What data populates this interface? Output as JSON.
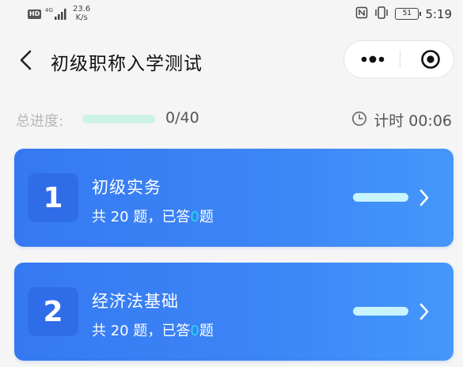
{
  "status_bar": {
    "hd": "HD",
    "network": "4G",
    "speed_value": "23.6",
    "speed_unit": "K/s",
    "battery": "51",
    "time": "5:19"
  },
  "header": {
    "title": "初级职称入学测试"
  },
  "progress": {
    "label": "总进度:",
    "count": "0/40",
    "fraction": 0,
    "timer": "计时 00:06"
  },
  "colors": {
    "card_blue": "#3579f2",
    "answered_cyan": "#29d6f2",
    "progress_track": "#cdf2e8"
  },
  "sections": [
    {
      "number": "1",
      "title": "初级实务",
      "sub_prefix": "共 20 题，已答",
      "answered": "0",
      "sub_suffix": "题",
      "progress_fraction": 0
    },
    {
      "number": "2",
      "title": "经济法基础",
      "sub_prefix": "共 20 题，已答",
      "answered": "0",
      "sub_suffix": "题",
      "progress_fraction": 0
    }
  ]
}
